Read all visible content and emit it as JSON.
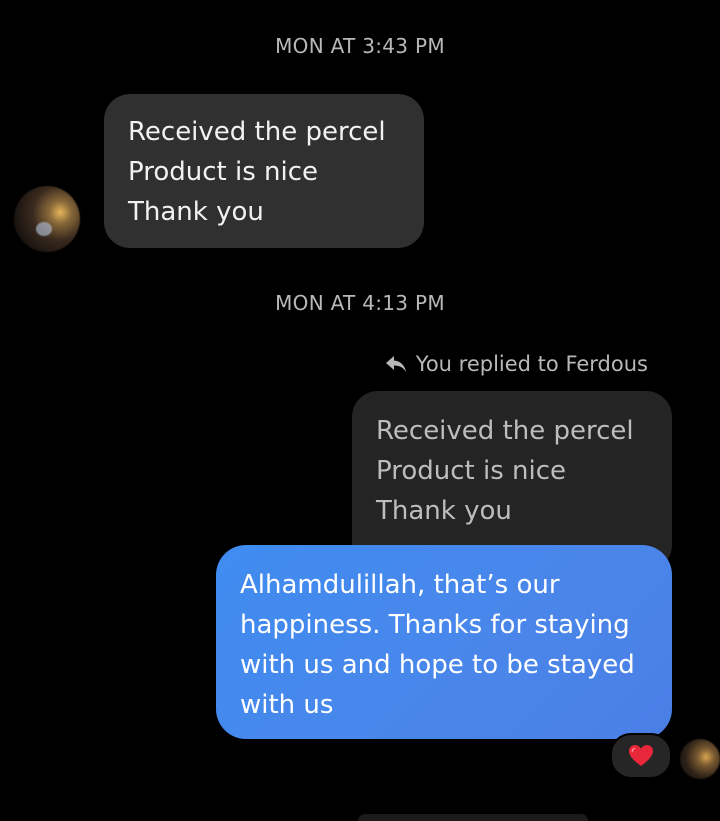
{
  "messages": {
    "timestamp_1": "MON AT 3:43 PM",
    "incoming_text": "Received the percel\nProduct is nice\nThank you",
    "timestamp_2": "MON AT 4:13 PM",
    "reply_label": "You replied to Ferdous",
    "quoted_text": "Received the percel\nProduct is nice\nThank you",
    "outgoing_text": "Alhamdulillah, that’s our\nhappiness. Thanks for staying\nwith us and hope to be stayed\nwith us",
    "reaction": "heart"
  },
  "colors": {
    "background": "#000000",
    "incoming_bubble": "#303030",
    "quoted_bubble": "#242424",
    "outgoing_bubble": "#4a86ea",
    "reaction_heart": "#e8283a"
  },
  "icons": {
    "reply": "reply-arrow-icon",
    "reaction": "heart-icon"
  }
}
